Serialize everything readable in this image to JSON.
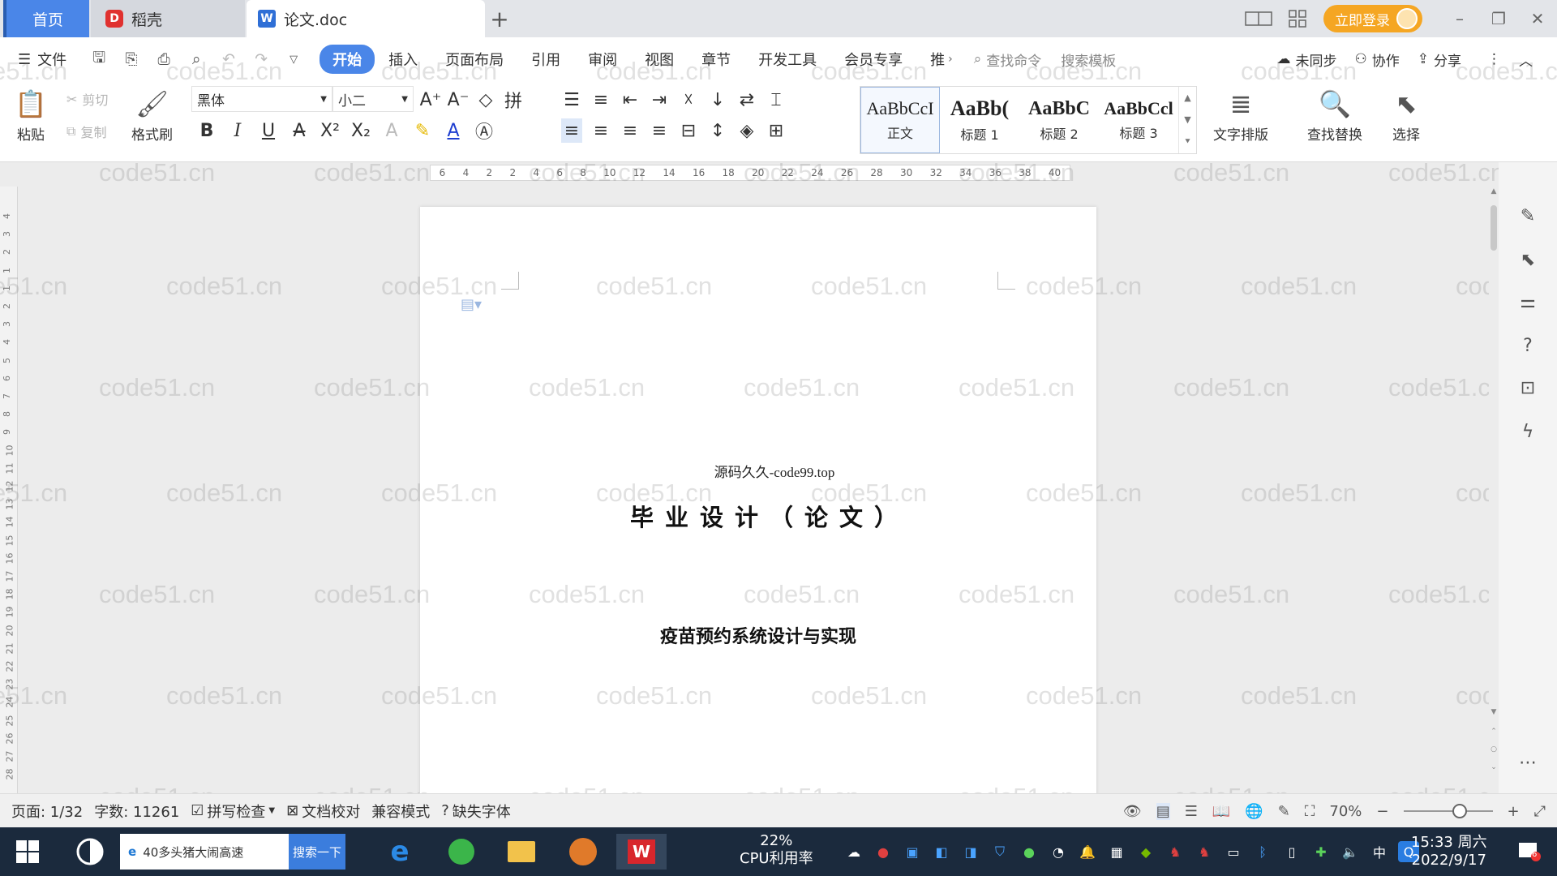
{
  "tabs": {
    "home": "首页",
    "daoke": "稻壳",
    "doc": "论文.doc",
    "add": "+"
  },
  "titlebar": {
    "login": "立即登录"
  },
  "menu": {
    "file": "文件",
    "tabs": [
      "开始",
      "插入",
      "页面布局",
      "引用",
      "审阅",
      "视图",
      "章节",
      "开发工具",
      "会员专享",
      "推"
    ],
    "active_tab": "开始",
    "search_command": "查找命令",
    "search_template": "搜索模板",
    "sync": "未同步",
    "collab": "协作",
    "share": "分享"
  },
  "ribbon": {
    "paste": "粘贴",
    "cut": "剪切",
    "copy": "复制",
    "format_painter": "格式刷",
    "font_name": "黑体",
    "font_size": "小二",
    "styles": [
      {
        "preview": "AaBbCcI",
        "name": "正文"
      },
      {
        "preview": "AaBb(",
        "name": "标题 1"
      },
      {
        "preview": "AaBbC",
        "name": "标题 2"
      },
      {
        "preview": "AaBbCcl",
        "name": "标题 3"
      }
    ],
    "text_layout": "文字排版",
    "find_replace": "查找替换",
    "select": "选择"
  },
  "ruler": {
    "ticks": [
      "6",
      "4",
      "2",
      "2",
      "4",
      "6",
      "8",
      "10",
      "12",
      "14",
      "16",
      "18",
      "20",
      "22",
      "24",
      "26",
      "28",
      "30",
      "32",
      "34",
      "36",
      "38",
      "40"
    ],
    "vticks": [
      "4",
      "3",
      "2",
      "1",
      "1",
      "2",
      "3",
      "4",
      "5",
      "6",
      "7",
      "8",
      "9",
      "10",
      "11",
      "12",
      "13",
      "14",
      "15",
      "16",
      "17",
      "18",
      "19",
      "20",
      "21",
      "22",
      "23",
      "24",
      "25",
      "26",
      "27",
      "28"
    ]
  },
  "document": {
    "source_line": "源码久久-code99.top",
    "heading": "毕业设计（论文）",
    "subtitle": "疫苗预约系统设计与实现"
  },
  "watermark": "code51.cn",
  "status": {
    "page": "页面: 1/32",
    "word_count": "字数: 11261",
    "spell_check": "拼写检查",
    "doc_proof": "文档校对",
    "compat_mode": "兼容模式",
    "missing_font": "缺失字体",
    "zoom": "70%"
  },
  "taskbar": {
    "search_text": "40多头猪大闹高速",
    "search_button": "搜索一下",
    "cpu_percent": "22%",
    "cpu_label": "CPU利用率",
    "ime": "中",
    "time": "15:33 周六",
    "date": "2022/9/17",
    "notification_count": "6"
  },
  "colors": {
    "accent": "#4a86e8",
    "login": "#f5a623",
    "taskbar": "#1b2a3d"
  }
}
